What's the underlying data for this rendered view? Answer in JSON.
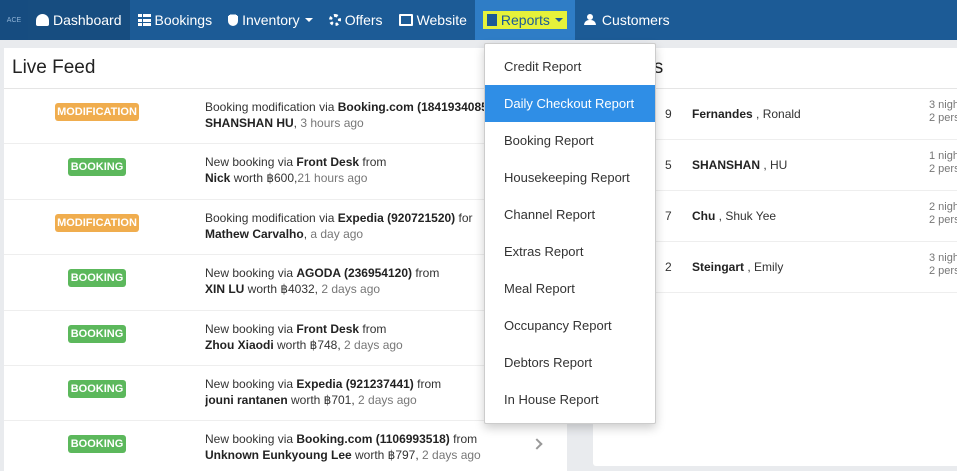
{
  "nav": {
    "brand": "ACE",
    "items": [
      {
        "label": "Dashboard",
        "icon": "dashboard-icon"
      },
      {
        "label": "Bookings",
        "icon": "grid-icon"
      },
      {
        "label": "Inventory",
        "icon": "database-icon"
      },
      {
        "label": "Offers",
        "icon": "gear-icon"
      },
      {
        "label": "Website",
        "icon": "monitor-icon"
      },
      {
        "label": "Reports",
        "icon": "document-icon"
      },
      {
        "label": "Customers",
        "icon": "users-icon"
      }
    ]
  },
  "colors": {
    "navbar": "#1c5b96",
    "active_menu": "#2f8ee6",
    "highlight": "#e6f23a",
    "modification": "#f0ad4e",
    "booking": "#5cb85c"
  },
  "live_feed": {
    "title": "Live Feed",
    "rows": [
      {
        "badge": "MODIFICATION",
        "pre": "Booking modification via ",
        "source": "Booking.com (1841934085)",
        "mid": "",
        "guest": "SHANSHAN HU",
        "tail": ", ",
        "when": "3 hours ago"
      },
      {
        "badge": "BOOKING",
        "pre": "New booking via ",
        "source": "Front Desk",
        "mid": " from ",
        "guest": "Nick",
        "tail": " worth ฿600,",
        "when": "21 hours ago"
      },
      {
        "badge": "MODIFICATION",
        "pre": "Booking modification via ",
        "source": "Expedia (920721520)",
        "mid": " for",
        "guest": "Mathew Carvalho",
        "tail": ", ",
        "when": "a day ago"
      },
      {
        "badge": "BOOKING",
        "pre": "New booking via ",
        "source": "AGODA (236954120)",
        "mid": " from ",
        "guest": "XIN LU",
        "tail": " worth ฿4032, ",
        "when": "2 days ago"
      },
      {
        "badge": "BOOKING",
        "pre": "New booking via ",
        "source": "Front Desk",
        "mid": " from ",
        "guest": "Zhou Xiaodi",
        "tail": " worth ฿748, ",
        "when": "2 days ago"
      },
      {
        "badge": "BOOKING",
        "pre": "New booking via ",
        "source": "Expedia (921237441)",
        "mid": " from ",
        "guest": "jouni rantanen",
        "tail": " worth ฿701, ",
        "when": "2 days ago"
      },
      {
        "badge": "BOOKING",
        "pre": "New booking via ",
        "source": "Booking.com (1106993518)",
        "mid": " from",
        "guest": "Unknown Eunkyoung Lee",
        "tail": " worth ฿797, ",
        "when": "2 days ago"
      }
    ]
  },
  "checkins": {
    "title_fragment": "ins",
    "rows": [
      {
        "num": "9",
        "last": "Fernandes",
        "first": ", Ronald",
        "nights": "3 nigh",
        "persons": "2 pers"
      },
      {
        "num": "5",
        "last": "SHANSHAN",
        "first": ", HU",
        "nights": "1 nigh",
        "persons": "2 pers"
      },
      {
        "num": "7",
        "last": "Chu",
        "first": ", Shuk Yee",
        "nights": "2 nigh",
        "persons": "2 pers"
      },
      {
        "num": "2",
        "last": "Steingart",
        "first": ", Emily",
        "nights": "3 nigh",
        "persons": "2 pers"
      }
    ]
  },
  "reports_menu": {
    "items": [
      "Credit Report",
      "Daily Checkout Report",
      "Booking Report",
      "Housekeeping Report",
      "Channel Report",
      "Extras Report",
      "Meal Report",
      "Occupancy Report",
      "Debtors Report",
      "In House Report"
    ],
    "hovered": "Daily Checkout Report"
  }
}
